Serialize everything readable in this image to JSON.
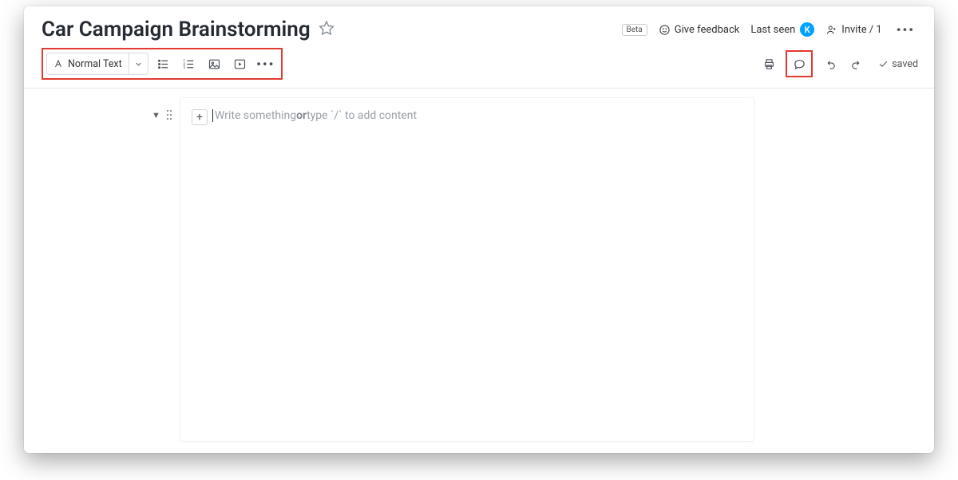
{
  "colors": {
    "highlight": "#e23a2f",
    "accent": "#00a3ff"
  },
  "header": {
    "title": "Car Campaign Brainstorming",
    "beta_label": "Beta",
    "feedback_label": "Give feedback",
    "lastseen_label": "Last seen",
    "avatar_initial": "K",
    "invite_label": "Invite / 1"
  },
  "toolbar": {
    "style_label": "Normal Text",
    "icons": [
      "letter-a-icon",
      "bullet-list-icon",
      "numbered-list-icon",
      "image-icon",
      "video-icon",
      "more-icon"
    ],
    "right_icons": [
      "print-icon",
      "comment-icon",
      "undo-icon",
      "redo-icon"
    ],
    "saved_label": "saved"
  },
  "editor": {
    "placeholder_pre": "Write something ",
    "placeholder_bold": "or",
    "placeholder_post": " type `/` to add content"
  }
}
